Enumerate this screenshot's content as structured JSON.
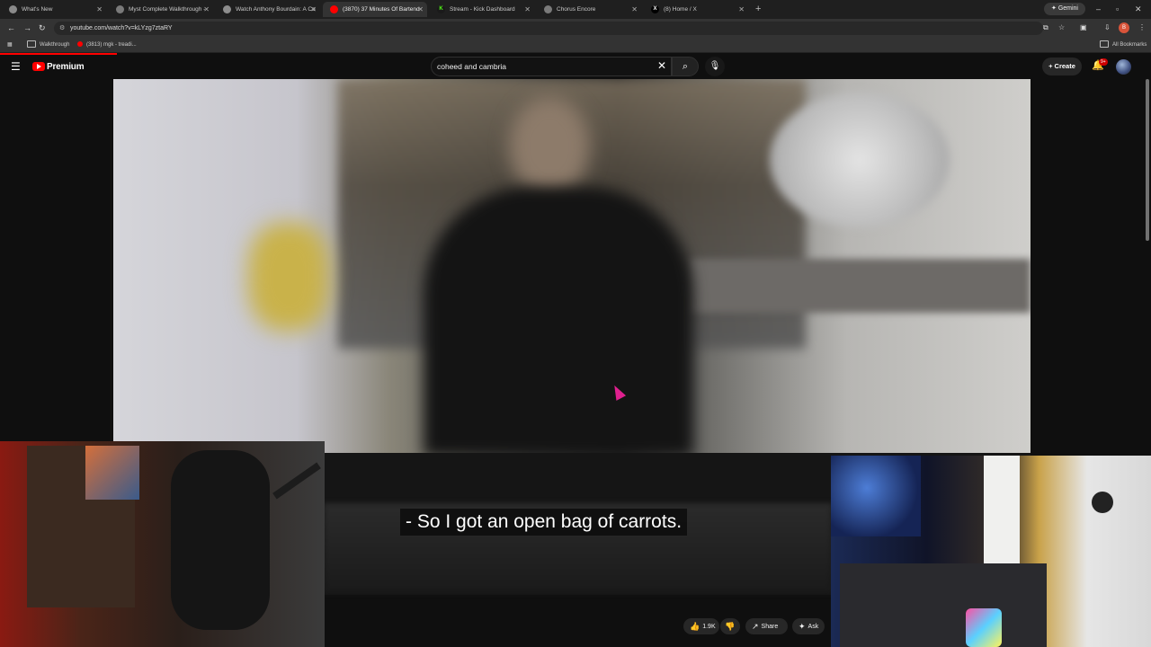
{
  "browser": {
    "tabs": [
      {
        "title": "What's New",
        "favicon_color": "#8a8a8a",
        "glyph": ""
      },
      {
        "title": "Myst Complete Walkthrough - ",
        "favicon_color": "#7a7a7a",
        "glyph": ""
      },
      {
        "title": "Watch Anthony Bourdain: A Co",
        "favicon_color": "#8d8d8d",
        "glyph": ""
      },
      {
        "title": "(3870) 37 Minutes Of Bartend",
        "favicon_color": "#ff0000",
        "glyph": ""
      },
      {
        "title": "Stream - Kick Dashboard",
        "favicon_color": "#53fc18",
        "glyph": "K"
      },
      {
        "title": "Chorus Encore",
        "favicon_color": "#7a7a7a",
        "glyph": ""
      },
      {
        "title": "(8) Home / X",
        "favicon_color": "#000000",
        "glyph": "X"
      }
    ],
    "new_tab": "+",
    "gemini_label": "Gemini",
    "url": "youtube.com/watch?v=kLYzg7ztaRY",
    "profile_initial": "B",
    "bookmarks": [
      {
        "label": "Walkthrough",
        "kind": "folder"
      },
      {
        "label": "(3813) mgk - treadi...",
        "kind": "youtube"
      }
    ],
    "all_bookmarks": "All Bookmarks"
  },
  "youtube": {
    "brand": "Premium",
    "search_query": "coheed and cambria",
    "create_label": "Create",
    "notifications_badge": "9+"
  },
  "video": {
    "caption": "- So I got an open bag of carrots."
  },
  "actions": {
    "likes": "1.9K",
    "share": "Share",
    "ask": "Ask"
  },
  "colors": {
    "youtube_red": "#ff0000",
    "cursor": "#e0208f",
    "background": "#0f0f0f"
  }
}
